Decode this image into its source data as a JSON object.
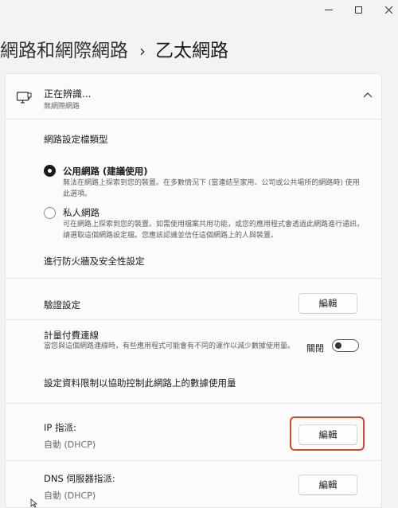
{
  "window": {
    "minimize_icon": "minimize-icon",
    "maximize_icon": "maximize-icon",
    "close_icon": "close-icon"
  },
  "breadcrumb": {
    "parent": "網路和網際網路",
    "separator": "›",
    "current": "乙太網路"
  },
  "network": {
    "name": "正在辨識...",
    "status": "無網際網路",
    "icon": "ethernet-monitor-icon"
  },
  "profile": {
    "title": "網路設定檔類型",
    "public_label": "公用網路 (建議使用)",
    "public_desc": "無法在網路上探索到您的裝置。在多數情況下 (當連結至家用、公司或公共場所的網路時) 使用此選項。",
    "private_label": "私人網路",
    "private_desc": "可在網路上探索到您的裝置。如需使用檔案共用功能，或您的應用程式會透過此網路進行通訊，請選取這個網路設定檔。您應該認識並信任這個網路上的人與裝置。",
    "selected": "public"
  },
  "firewall_link": "進行防火牆及安全性設定",
  "auth": {
    "label": "驗證設定",
    "button": "編輯"
  },
  "metered": {
    "label": "計量付費連線",
    "desc": "當您與這個網路連線時，有些應用程式可能會有不同的運作以減少數據使用量。",
    "toggle_label": "關閉",
    "toggle_on": false
  },
  "data_limit_link": "設定資料限制以協助控制此網路上的數據使用量",
  "ip": {
    "label": "IP 指派:",
    "value": "自動 (DHCP)",
    "button": "編輯",
    "highlight_color": "#d24a2a"
  },
  "dns": {
    "label": "DNS 伺服器指派:",
    "value": "自動 (DHCP)",
    "button": "編輯"
  }
}
